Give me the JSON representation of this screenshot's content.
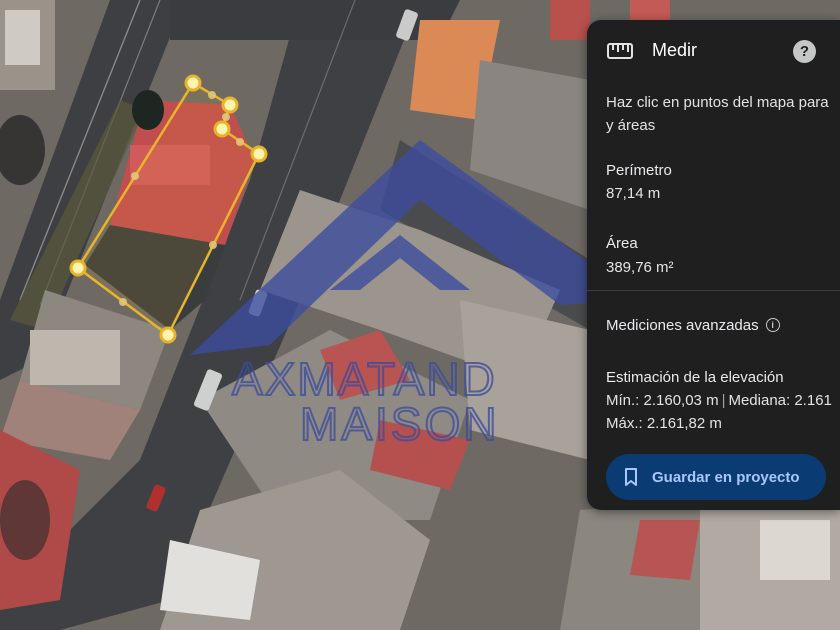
{
  "watermark": {
    "line1": "AXMATAND",
    "line2": "MAISON"
  },
  "measure_panel": {
    "title": "Medir",
    "title_icon": "ruler-icon",
    "help_label": "?",
    "instructions_line1": "Haz clic en puntos del mapa para",
    "instructions_line2": "y áreas",
    "perimeter_label": "Perímetro",
    "perimeter_value": "87,14 m",
    "area_label": "Área",
    "area_value": "389,76 m²",
    "advanced_label": "Mediciones avanzadas",
    "elevation_label": "Estimación de la elevación",
    "elevation_min": "Mín.: 2.160,03 m",
    "elevation_median": "Mediana: 2.161",
    "elevation_max": "Máx.: 2.161,82 m",
    "save_button_label": "Guardar en proyecto",
    "save_icon": "bookmark-icon"
  },
  "colors": {
    "polygon_stroke": "#e8b52a",
    "vertex_fill": "#fff3b0",
    "watermark": "#3c4c9e",
    "panel_bg": "#1f1f1f",
    "button_bg": "#0b3b73",
    "button_text": "#a8c7fa"
  }
}
